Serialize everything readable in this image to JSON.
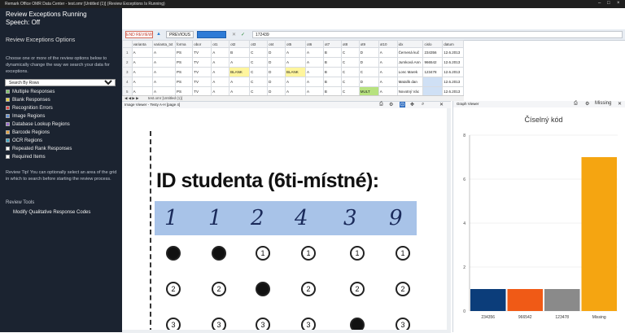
{
  "window": {
    "title": "Remark Office OMR Data Center - test.omr [Untitled (1)] (Review Exceptions Is Running)"
  },
  "panel": {
    "status_line1": "Review Exceptions Running",
    "status_line2": "Speech: Off",
    "options_title": "Review Exceptions Options",
    "description": "Choose one or more of the review options below to dynamically change the way we search your data for exceptions.",
    "search_select": "Search By Rows",
    "options": [
      {
        "label": "Multiple Responses",
        "color": "#7cc36a",
        "checked": true
      },
      {
        "label": "Blank Responses",
        "color": "#e8d33f",
        "checked": true
      },
      {
        "label": "Recognition Errors",
        "color": "#e04848",
        "checked": true
      },
      {
        "label": "Image Regions",
        "color": "#5f8fd6",
        "checked": true
      },
      {
        "label": "Database Lookup Regions",
        "color": "#9a6bd0",
        "checked": true
      },
      {
        "label": "Barcode Regions",
        "color": "#e0a040",
        "checked": true
      },
      {
        "label": "OCR Regions",
        "color": "#3fa9c8",
        "checked": true
      },
      {
        "label": "Repeated Rank Responses",
        "color": "#ffffff",
        "checked": false
      },
      {
        "label": "Required Items",
        "color": "#ffffff",
        "checked": false
      }
    ],
    "tip": "Review Tip! You can optionally select an area of the grid in which to search before starting the review process.",
    "tools_title": "Review Tools",
    "tools_item": "Modify Qualitative Response Codes"
  },
  "toolbar": {
    "end_review": "END REVIEW",
    "previous": "PREVIOUS",
    "value": "172439"
  },
  "grid": {
    "columns": [
      "",
      "varianta",
      "varianta_txt",
      "forma",
      "obor",
      "ot1",
      "ot2",
      "ot3",
      "ot4",
      "ot5",
      "ot6",
      "ot7",
      "ot8",
      "ot9",
      "ot10",
      "idx",
      "cislo",
      "datum"
    ],
    "rows": [
      [
        "1",
        "A",
        "A",
        "PS",
        "TV",
        "A",
        "B",
        "C",
        "D",
        "A",
        "A",
        "B",
        "C",
        "D",
        "A",
        "Černená kuč",
        "234356",
        "12.6.2013"
      ],
      [
        "2",
        "A",
        "A",
        "PS",
        "TV",
        "A",
        "A",
        "C",
        "D",
        "A",
        "A",
        "B",
        "C",
        "D",
        "A",
        "Jumková Ann",
        "966542",
        "12.6.2013"
      ],
      [
        "3",
        "A",
        "A",
        "PS",
        "TV",
        "A",
        "BLANK",
        "C",
        "D",
        "BLANK",
        "A",
        "B",
        "C",
        "C",
        "A",
        "Lonc Marek",
        "123478",
        "12.6.2013"
      ],
      [
        "4",
        "A",
        "A",
        "PS",
        "TV",
        "A",
        "A",
        "C",
        "D",
        "A",
        "A",
        "B",
        "C",
        "D",
        "A",
        "Matalík dan",
        "",
        "12.6.2013"
      ],
      [
        "5",
        "A",
        "A",
        "PS",
        "TV",
        "A",
        "A",
        "C",
        "D",
        "A",
        "A",
        "B",
        "C",
        "MULT",
        "A",
        "Novotný Vác",
        "",
        "12.6.2013"
      ]
    ],
    "footer": "test.omr [Untitled (1)]"
  },
  "image_viewer": {
    "title": "Image Viewer - Testy A-H  [page 4]",
    "sheet_title": "ID studenta (6ti-místné):",
    "digits": [
      "1",
      "1",
      "2",
      "4",
      "3",
      "9"
    ],
    "bubble_rows": [
      {
        "label": "1",
        "filled": [
          true,
          true,
          false,
          false,
          false,
          false
        ]
      },
      {
        "label": "2",
        "filled": [
          false,
          false,
          true,
          false,
          false,
          false
        ]
      },
      {
        "label": "3",
        "filled": [
          false,
          false,
          false,
          false,
          true,
          false
        ]
      }
    ]
  },
  "graph_viewer": {
    "title": "Graph Viewer",
    "missing_label": "Missing"
  },
  "chart_data": {
    "type": "bar",
    "title": "Číselný kód",
    "categories": [
      "234356",
      "966542",
      "123478",
      "Missing"
    ],
    "values": [
      1,
      1,
      1,
      7
    ],
    "colors": [
      "#0b3d7a",
      "#f05a16",
      "#8a8a8a",
      "#f5a511"
    ],
    "ylim": [
      0,
      8
    ],
    "yticks": [
      0,
      2,
      4,
      6,
      8
    ],
    "grid": true
  }
}
